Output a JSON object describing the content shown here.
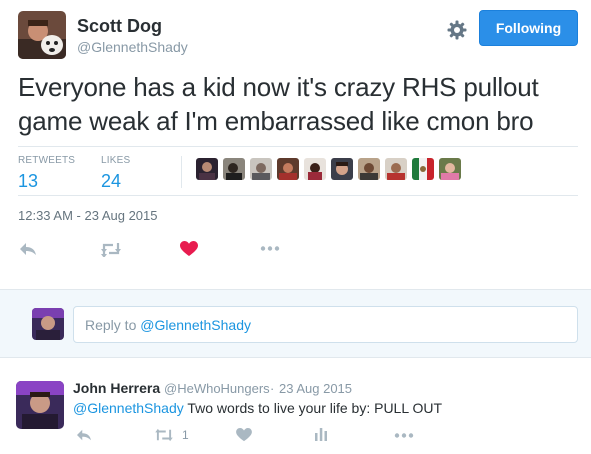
{
  "tweet": {
    "display_name": "Scott Dog",
    "screen_name": "@GlennethShady",
    "follow_label": "Following",
    "text": "Everyone has a kid now it's crazy RHS pullout game weak af I'm embarrassed like cmon bro",
    "timestamp": "12:33 AM - 23 Aug 2015",
    "stats": {
      "retweets_label": "RETWEETS",
      "retweets_count": "13",
      "likes_label": "LIKES",
      "likes_count": "24"
    },
    "liker_avatar_count": 10,
    "liked": true,
    "colors": {
      "accent": "#1b95e0",
      "follow_button": "#2b8fe8",
      "heart": "#e81c4f",
      "muted": "#8899a6"
    }
  },
  "reply_box": {
    "prefix": "Reply to ",
    "mention": "@GlennethShady"
  },
  "reply": {
    "display_name": "John Herrera",
    "screen_name": "@HeWhoHungers",
    "separator": "·",
    "date": "23 Aug 2015",
    "mention": "@GlennethShady",
    "text": " Two words to live your life by: PULL OUT",
    "retweet_count": "1"
  },
  "icons": [
    "gear-icon",
    "reply-icon",
    "retweet-icon",
    "heart-icon",
    "more-icon",
    "analytics-icon"
  ]
}
